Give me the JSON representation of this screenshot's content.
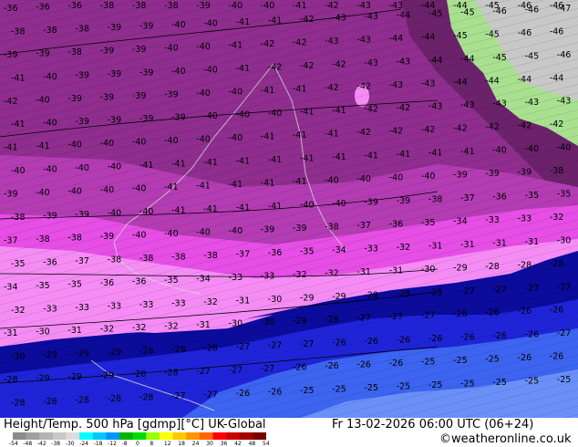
{
  "title_left": "Height/Temp. 500 hPa [gdmp][°C] UK-Global",
  "title_right": "Fr 13-02-2026 06:00 UTC (06+24)",
  "credit": "©weatheronline.co.uk",
  "colorbar": {
    "ticks": [
      "-54",
      "-48",
      "-42",
      "-38",
      "-30",
      "-24",
      "-18",
      "-12",
      "-8",
      "0",
      "8",
      "12",
      "18",
      "24",
      "30",
      "36",
      "42",
      "48",
      "54"
    ],
    "colors": [
      "#8c8c8c",
      "#a0a0a0",
      "#b4b4b4",
      "#c8c8c8",
      "#dcdcdc",
      "#00ffff",
      "#00c8ff",
      "#0096ff",
      "#00b400",
      "#00dc00",
      "#96ff00",
      "#ffff00",
      "#ffc800",
      "#ff9600",
      "#ff6400",
      "#ff0000",
      "#c80000",
      "#a00000",
      "#780000"
    ]
  },
  "map": {
    "colors": {
      "deep_purple": "#6b226b",
      "purple": "#8f2e8f",
      "magenta_dark": "#b33cb3",
      "magenta": "#e64ee6",
      "pink": "#f58cf5",
      "navy": "#0b0b9c",
      "blue": "#1f24d8",
      "blue_light": "#3c64f0",
      "sky": "#6a90f8",
      "land": "#a8e090",
      "coast": "#c8c8c8"
    },
    "temperature_rows": [
      [
        "-36",
        "-36",
        "-36",
        "-38",
        "-38",
        "-38",
        "-39",
        "-40",
        "-40",
        "-41",
        "-42",
        "-43",
        "-43",
        "-44",
        "-44",
        "-45",
        "-46",
        "-46"
      ],
      [
        "-38",
        "-38",
        "-38",
        "-39",
        "-39",
        "-40",
        "-40",
        "-41",
        "-41",
        "-42",
        "-43",
        "-43",
        "-44",
        "-45",
        "-45",
        "-46",
        "-46",
        "-47"
      ],
      [
        "-39",
        "-39",
        "-38",
        "-39",
        "-39",
        "-40",
        "-40",
        "-41",
        "-42",
        "-42",
        "-43",
        "-43",
        "-44",
        "-44",
        "-45",
        "-45",
        "-46",
        "-46"
      ],
      [
        "-41",
        "-40",
        "-39",
        "-39",
        "-39",
        "-40",
        "-40",
        "-41",
        "-42",
        "-42",
        "-42",
        "-43",
        "-43",
        "-44",
        "-44",
        "-45",
        "-45",
        "-46"
      ],
      [
        "-42",
        "-40",
        "-39",
        "-39",
        "-39",
        "-39",
        "-40",
        "-40",
        "-41",
        "-41",
        "-42",
        "-42",
        "-43",
        "-43",
        "-44",
        "-44",
        "-44",
        "-44"
      ],
      [
        "-41",
        "-40",
        "-39",
        "-39",
        "-39",
        "-39",
        "-40",
        "-40",
        "-40",
        "-41",
        "-41",
        "-42",
        "-42",
        "-43",
        "-43",
        "-43",
        "-43",
        "-43"
      ],
      [
        "-41",
        "-41",
        "-40",
        "-40",
        "-40",
        "-40",
        "-40",
        "-40",
        "-41",
        "-41",
        "-41",
        "-42",
        "-42",
        "-42",
        "-42",
        "-42",
        "-42",
        "-42"
      ],
      [
        "-40",
        "-40",
        "-40",
        "-40",
        "-41",
        "-41",
        "-41",
        "-41",
        "-41",
        "-41",
        "-41",
        "-41",
        "-41",
        "-41",
        "-41",
        "-40",
        "-40",
        "-40"
      ],
      [
        "-39",
        "-40",
        "-40",
        "-40",
        "-40",
        "-41",
        "-41",
        "-41",
        "-41",
        "-41",
        "-40",
        "-40",
        "-40",
        "-40",
        "-39",
        "-39",
        "-39",
        "-38"
      ],
      [
        "-38",
        "-39",
        "-39",
        "-40",
        "-40",
        "-41",
        "-41",
        "-41",
        "-41",
        "-40",
        "-40",
        "-39",
        "-39",
        "-38",
        "-37",
        "-36",
        "-35",
        "-35"
      ],
      [
        "-37",
        "-38",
        "-38",
        "-39",
        "-40",
        "-40",
        "-40",
        "-40",
        "-39",
        "-39",
        "-38",
        "-37",
        "-36",
        "-35",
        "-34",
        "-33",
        "-33",
        "-32"
      ],
      [
        "-35",
        "-36",
        "-37",
        "-38",
        "-38",
        "-38",
        "-38",
        "-37",
        "-36",
        "-35",
        "-34",
        "-33",
        "-32",
        "-31",
        "-31",
        "-31",
        "-31",
        "-30"
      ],
      [
        "-34",
        "-35",
        "-35",
        "-36",
        "-36",
        "-35",
        "-34",
        "-33",
        "-33",
        "-32",
        "-32",
        "-31",
        "-31",
        "-30",
        "-29",
        "-28",
        "-28",
        "-28"
      ],
      [
        "-32",
        "-33",
        "-33",
        "-33",
        "-33",
        "-33",
        "-32",
        "-31",
        "-30",
        "-29",
        "-29",
        "-28",
        "-28",
        "-28",
        "-27",
        "-27",
        "-27",
        "-27"
      ],
      [
        "-31",
        "-30",
        "-31",
        "-32",
        "-32",
        "-32",
        "-31",
        "-30",
        "-30",
        "-29",
        "-28",
        "-27",
        "-27",
        "-27",
        "-26",
        "-26",
        "-26",
        "-26"
      ],
      [
        "-30",
        "-29",
        "-29",
        "-29",
        "-28",
        "-28",
        "-28",
        "-27",
        "-27",
        "-27",
        "-26",
        "-26",
        "-26",
        "-26",
        "-26",
        "-26",
        "-26",
        "-27"
      ],
      [
        "-28",
        "-29",
        "-29",
        "-29",
        "-28",
        "-28",
        "-27",
        "-27",
        "-27",
        "-26",
        "-26",
        "-26",
        "-26",
        "-25",
        "-25",
        "-25",
        "-26",
        "-26"
      ],
      [
        "-28",
        "-28",
        "-28",
        "-28",
        "-28",
        "-27",
        "-27",
        "-26",
        "-26",
        "-25",
        "-25",
        "-25",
        "-25",
        "-25",
        "-25",
        "-25",
        "-25",
        "-25"
      ]
    ],
    "level_labels": [
      "-36",
      "-32",
      "-28",
      "-26",
      "-24"
    ]
  }
}
